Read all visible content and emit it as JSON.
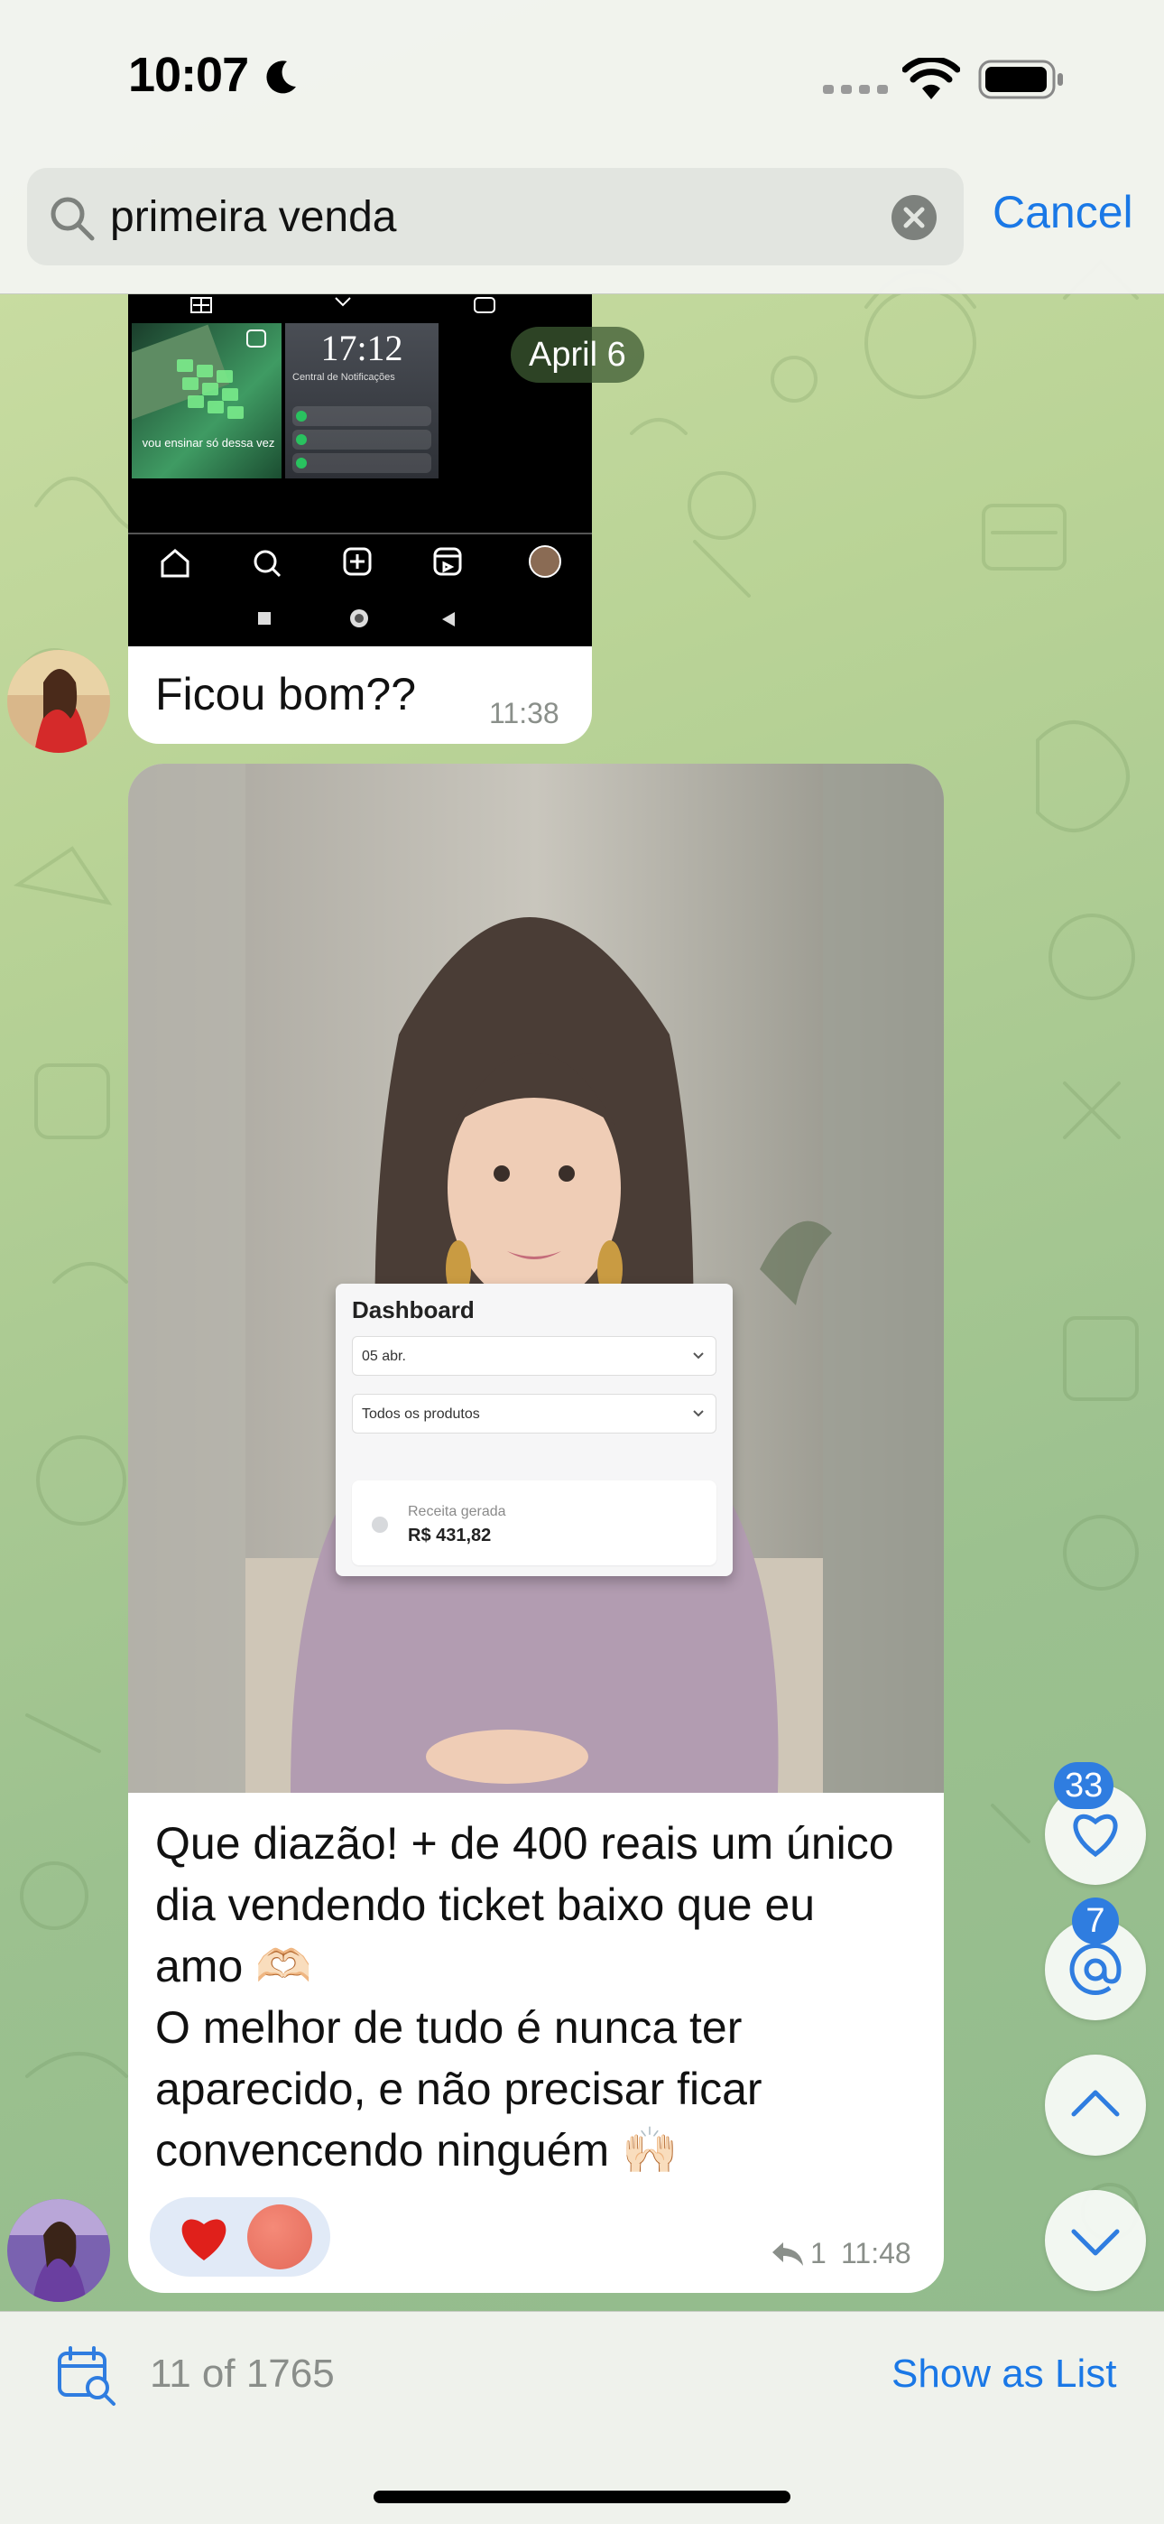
{
  "status_bar": {
    "time": "10:07",
    "icons": [
      "moon-icon",
      "cellular-dots-icon",
      "wifi-icon",
      "battery-icon"
    ]
  },
  "search": {
    "query": "primeira venda",
    "placeholder": "Search",
    "cancel_label": "Cancel"
  },
  "chat": {
    "date_separator": "April 6",
    "messages": [
      {
        "sender_avatar": "avatar-woman-red-dress",
        "media": {
          "type": "screenshot",
          "embedded": {
            "reel_caption": "vou ensinar só dessa vez",
            "lock_time": "17:12",
            "notification_center_label": "Central de Notificações"
          }
        },
        "text": "Ficou bom??",
        "time": "11:38"
      },
      {
        "sender_avatar": "avatar-woman-purple-field",
        "media": {
          "type": "photo",
          "dashboard": {
            "title": "Dashboard",
            "date_filter": "05 abr.",
            "product_filter": "Todos os produtos",
            "metric_label": "Receita gerada",
            "metric_value": "R$  431,82"
          }
        },
        "text": "Que diazão! + de 400 reais um único\ndia vendendo ticket baixo que eu\namo 🫶🏻\nO melhor de tudo é nunca ter\naparecido, e não precisar ficar\nconvencendo ninguém 🙌🏻",
        "reactions": [
          "red-heart",
          "peach-circle"
        ],
        "reply_count": "1",
        "time": "11:48"
      }
    ]
  },
  "floating_buttons": {
    "reactions_badge": "33",
    "mentions_badge": "7",
    "icons": [
      "heart-icon",
      "at-icon",
      "chevron-up-icon",
      "chevron-down-icon"
    ]
  },
  "bottom_bar": {
    "result_counter": "11 of 1765",
    "show_as_list_label": "Show as List"
  },
  "colors": {
    "accent": "#1a78e6",
    "badge": "#2f7de0",
    "bubble": "#ffffff",
    "date_pill": "#3c5a32"
  }
}
